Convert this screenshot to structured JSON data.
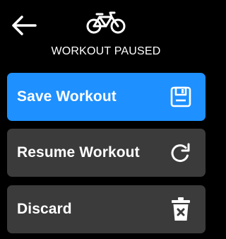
{
  "header": {
    "back_icon": "arrow-left-icon",
    "activity_icon": "bicycle-icon",
    "status_title": "WORKOUT PAUSED"
  },
  "actions": [
    {
      "id": "save",
      "label": "Save Workout",
      "icon": "floppy-disk-icon",
      "background": "#1e90ff"
    },
    {
      "id": "resume",
      "label": "Resume Workout",
      "icon": "rotate-clockwise-icon",
      "background": "#3b3b3b"
    },
    {
      "id": "discard",
      "label": "Discard",
      "icon": "trash-icon",
      "background": "#3b3b3b"
    }
  ],
  "colors": {
    "background": "#000000",
    "primary_accent": "#1e90ff",
    "secondary_button": "#3b3b3b",
    "text": "#ffffff"
  }
}
